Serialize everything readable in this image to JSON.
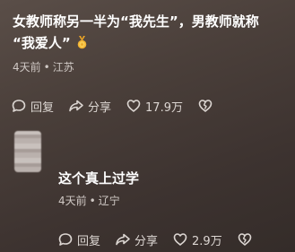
{
  "main_comment": {
    "text_line1": "女教师称另一半为“我先生”，男教师就称",
    "text_line2": "“我爱人”",
    "emoji": "medal-icon",
    "time": "4天前",
    "separator": "•",
    "location": "江苏",
    "actions": {
      "reply": "回复",
      "share": "分享",
      "likes": "17.9万"
    }
  },
  "reply_comment": {
    "text": "这个真上过学",
    "time": "4天前",
    "separator": "•",
    "location": "辽宁",
    "actions": {
      "reply": "回复",
      "share": "分享",
      "likes": "2.9万"
    }
  },
  "colors": {
    "background": "#4a3f3a",
    "text": "#ffffff",
    "meta_text": "#cfc8c4",
    "medal_gold": "#f2b233"
  }
}
